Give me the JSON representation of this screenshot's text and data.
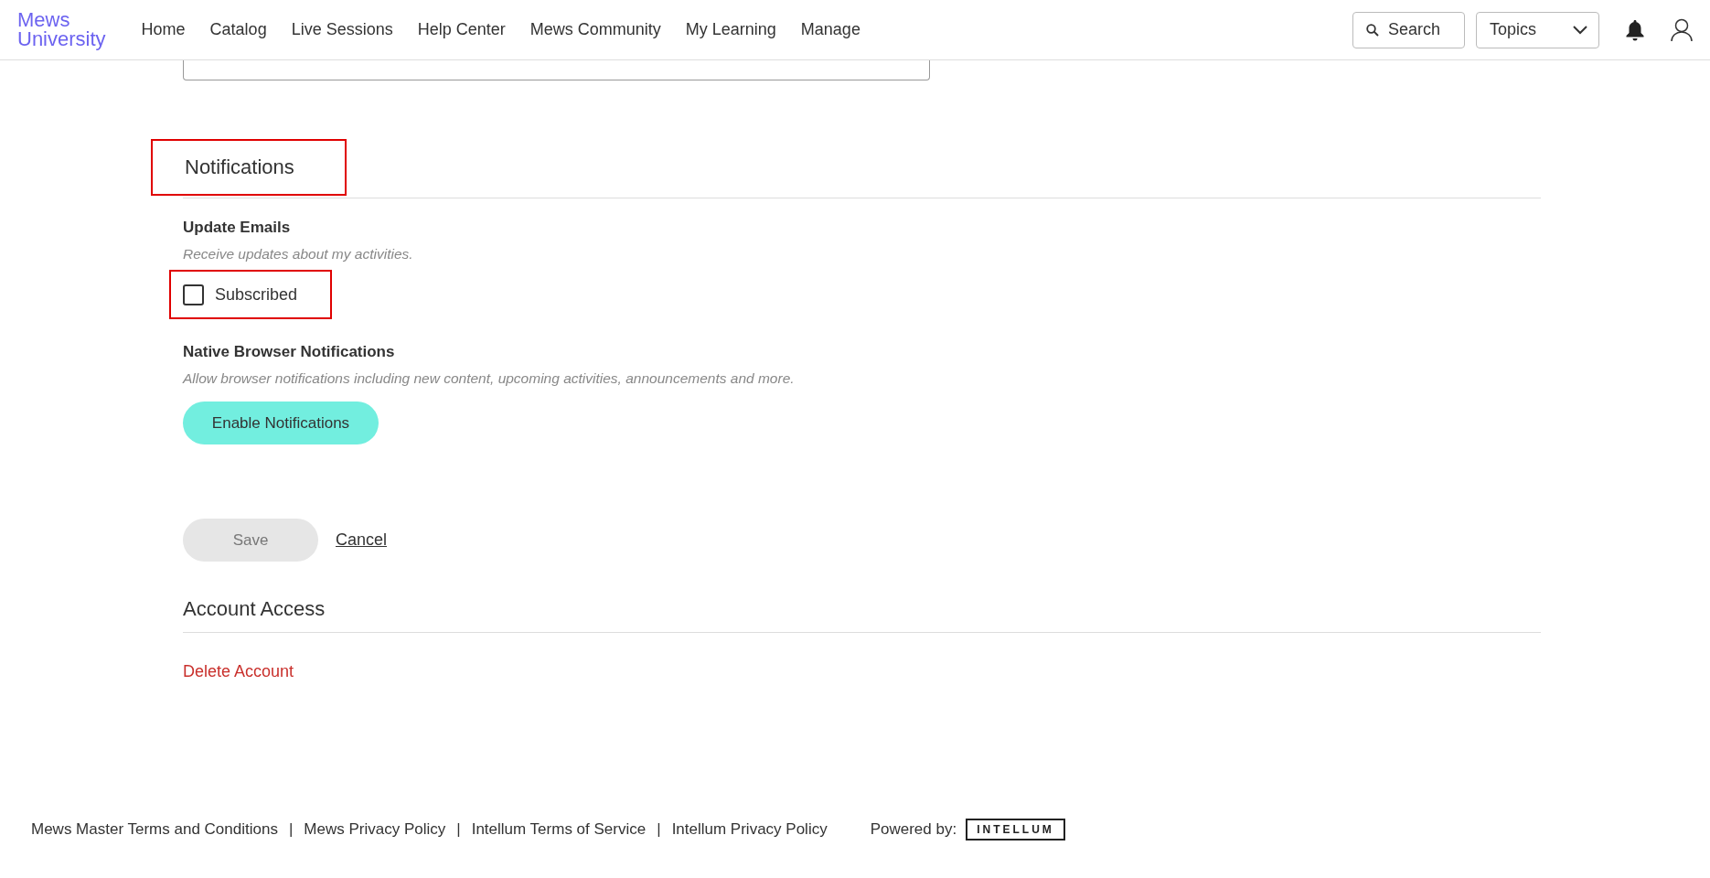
{
  "header": {
    "logo": [
      "Mews",
      "University"
    ],
    "nav": [
      {
        "label": "Home"
      },
      {
        "label": "Catalog"
      },
      {
        "label": "Live Sessions"
      },
      {
        "label": "Help Center"
      },
      {
        "label": "Mews Community"
      },
      {
        "label": "My Learning"
      },
      {
        "label": "Manage"
      }
    ],
    "search": {
      "label": "Search"
    },
    "topics": {
      "label": "Topics"
    }
  },
  "notifications": {
    "title": "Notifications",
    "highlighted": true,
    "update_emails": {
      "title": "Update Emails",
      "description": "Receive updates about my activities.",
      "option": {
        "label": "Subscribed",
        "checked": false,
        "highlighted": true
      }
    },
    "browser": {
      "title": "Native Browser Notifications",
      "description": "Allow browser notifications including new content, upcoming activities, announcements and more.",
      "button": "Enable Notifications"
    }
  },
  "actions": {
    "save": {
      "label": "Save",
      "disabled": true
    },
    "cancel": "Cancel"
  },
  "account_access": {
    "title": "Account Access",
    "delete": "Delete Account"
  },
  "footer": {
    "links": [
      "Mews Master Terms and Conditions",
      "Mews Privacy Policy",
      "Intellum Terms of Service",
      "Intellum Privacy Policy"
    ],
    "separator": "|",
    "powered_by": "Powered by:",
    "brand": "INTELLUM"
  }
}
